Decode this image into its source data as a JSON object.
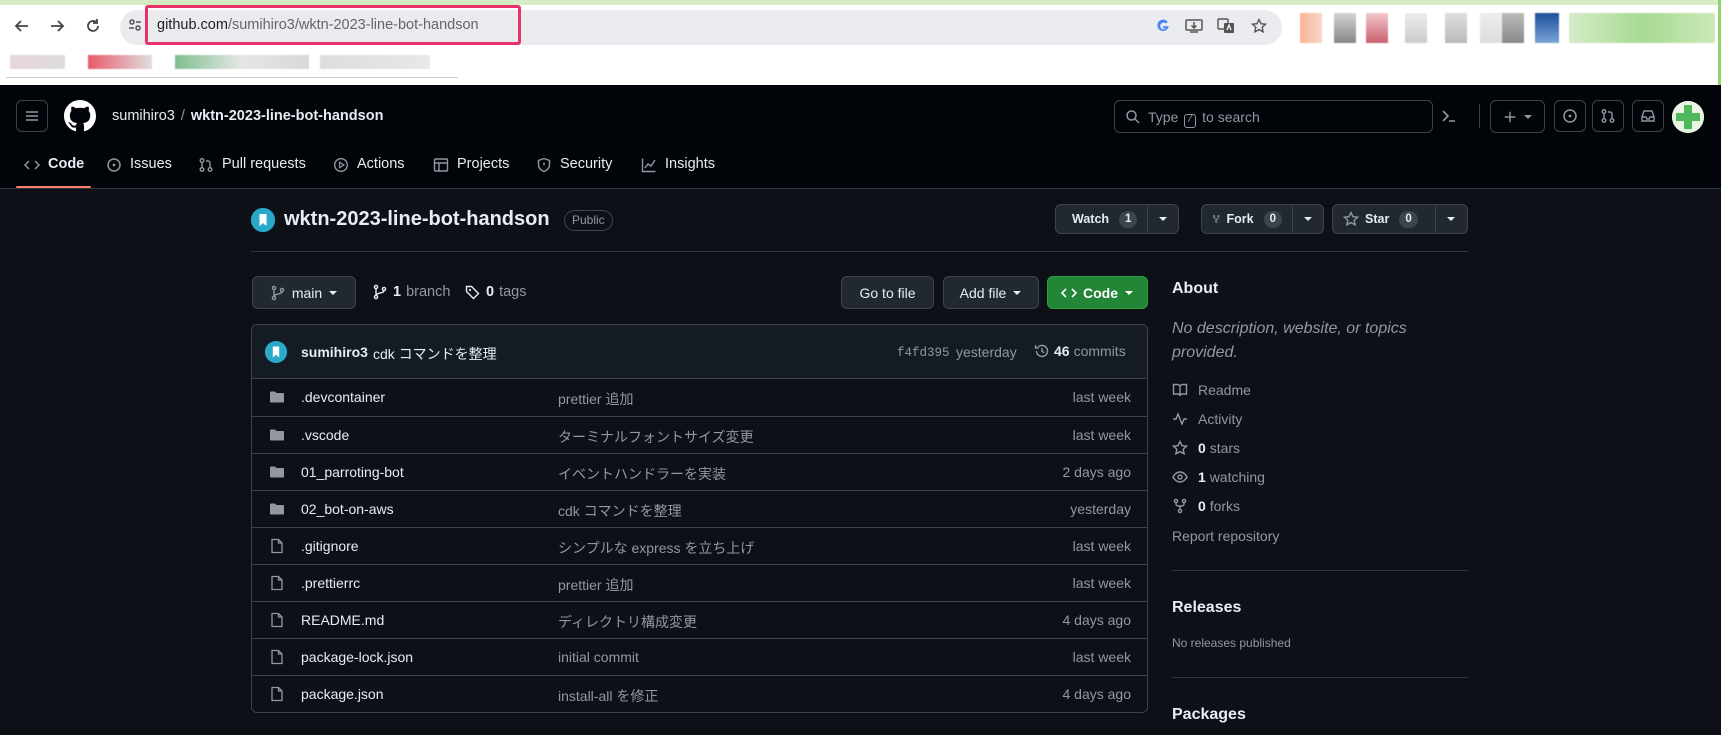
{
  "browser": {
    "url_host": "github.com",
    "url_path": "/sumihiro3/wktn-2023-line-bot-handson"
  },
  "header": {
    "owner": "sumihiro3",
    "separator": "/",
    "repo": "wktn-2023-line-bot-handson",
    "search_before": "Type",
    "search_key": "/",
    "search_after": "to search"
  },
  "tabs": [
    {
      "label": "Code",
      "icon": "code-icon"
    },
    {
      "label": "Issues",
      "icon": "issue-icon"
    },
    {
      "label": "Pull requests",
      "icon": "pull-request-icon"
    },
    {
      "label": "Actions",
      "icon": "play-icon"
    },
    {
      "label": "Projects",
      "icon": "table-icon"
    },
    {
      "label": "Security",
      "icon": "shield-icon"
    },
    {
      "label": "Insights",
      "icon": "graph-icon"
    }
  ],
  "repo": {
    "name": "wktn-2023-line-bot-handson",
    "visibility": "Public",
    "watch_label": "Watch",
    "watch_count": "1",
    "fork_label": "Fork",
    "fork_count": "0",
    "star_label": "Star",
    "star_count": "0"
  },
  "toolbar": {
    "branch": "main",
    "branch_count": "1",
    "branch_word": "branch",
    "tag_count": "0",
    "tag_word": "tags",
    "go_to_file": "Go to file",
    "add_file": "Add file",
    "code": "Code"
  },
  "latest_commit": {
    "author": "sumihiro3",
    "message": "cdk コマンドを整理",
    "hash": "f4fd395",
    "time": "yesterday",
    "count": "46",
    "count_word": "commits"
  },
  "files": [
    {
      "type": "folder",
      "name": ".devcontainer",
      "message": "prettier 追加",
      "time": "last week"
    },
    {
      "type": "folder",
      "name": ".vscode",
      "message": "ターミナルフォントサイズ変更",
      "time": "last week"
    },
    {
      "type": "folder",
      "name": "01_parroting-bot",
      "message": "イベントハンドラーを実装",
      "time": "2 days ago"
    },
    {
      "type": "folder",
      "name": "02_bot-on-aws",
      "message": "cdk コマンドを整理",
      "time": "yesterday"
    },
    {
      "type": "file",
      "name": ".gitignore",
      "message": "シンプルな express を立ち上げ",
      "time": "last week"
    },
    {
      "type": "file",
      "name": ".prettierrc",
      "message": "prettier 追加",
      "time": "last week"
    },
    {
      "type": "file",
      "name": "README.md",
      "message": "ディレクトリ構成変更",
      "time": "4 days ago"
    },
    {
      "type": "file",
      "name": "package-lock.json",
      "message": "initial commit",
      "time": "last week"
    },
    {
      "type": "file",
      "name": "package.json",
      "message": "install-all を修正",
      "time": "4 days ago"
    }
  ],
  "about": {
    "title": "About",
    "description": "No description, website, or topics provided.",
    "readme": "Readme",
    "activity": "Activity",
    "stars_count": "0",
    "stars_word": "stars",
    "watching_count": "1",
    "watching_word": "watching",
    "forks_count": "0",
    "forks_word": "forks",
    "report": "Report repository"
  },
  "releases": {
    "title": "Releases",
    "empty": "No releases published"
  },
  "packages": {
    "title": "Packages"
  },
  "colors": {
    "accent": "#f78166",
    "code_button": "#238636",
    "url_highlight": "#e8336a",
    "background": "#0d1117"
  }
}
